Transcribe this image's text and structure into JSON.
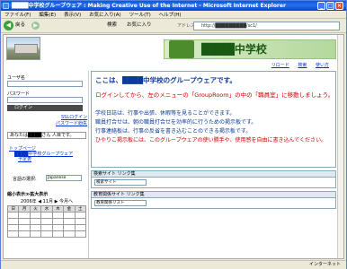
{
  "window": {
    "title": "████中学校グループウェア : Making Creative Use of the Internet - Microsoft Internet Explorer"
  },
  "menu": {
    "items": [
      "ファイル(F)",
      "編集(E)",
      "表示(V)",
      "お気に入り(A)",
      "ツール(T)",
      "ヘルプ(H)"
    ]
  },
  "toolbar": {
    "back": "戻る",
    "search": "検索",
    "favorites": "お気に入り",
    "address_label": "アドレス(D)",
    "address": "http://█████████/sc1/"
  },
  "header": {
    "school_name": "████中学校",
    "reload": "リロード",
    "search": "検索",
    "howto": "使い方"
  },
  "login": {
    "user_label": "ユーザ名",
    "pass_label": "パスワード",
    "login_button": "ログイン",
    "ssl_login": "SSLログイン",
    "pass_lost": "パスワード紛失"
  },
  "user": {
    "line": "あなたは████さん 人目です。"
  },
  "tree": {
    "top": "トップページ",
    "group": "████中学校グループウェア",
    "schedule": "予定表"
  },
  "lang": {
    "label": "言語の選択:",
    "value": "Japanese"
  },
  "calendar": {
    "title": "縮小表示≫拡大表示",
    "nav": "2006年 ◀ 11月 ▶ 今月へ",
    "days": [
      "日",
      "月",
      "火",
      "水",
      "木",
      "金",
      "土"
    ]
  },
  "main": {
    "welcome": "ここは、████中学校のグループウェアです。",
    "login_msg": "ログインしてから、左のメニューの「GroupRoom」の中の「職員室」に移動しましょう。",
    "info1": "学校日誌は、行事や出張、休暇等を見ることができます。",
    "info2": "職員打合せは、朝の職員打合せを効率的に行うための掲示板です。",
    "info3": "行事連絡板は、行事の反省を書き込むことのできる掲示板です。",
    "info4": "ひやりこ掲示板には、このグループウェアの使い勝手や、使用感を自由に書き込んでください。"
  },
  "portlets": [
    {
      "title": "検索サイト リンク集",
      "select": "検索サイト"
    },
    {
      "title": "教育関係サイト リンク集",
      "select": "教育関係リスト"
    }
  ],
  "status": {
    "zone": "インターネット"
  }
}
